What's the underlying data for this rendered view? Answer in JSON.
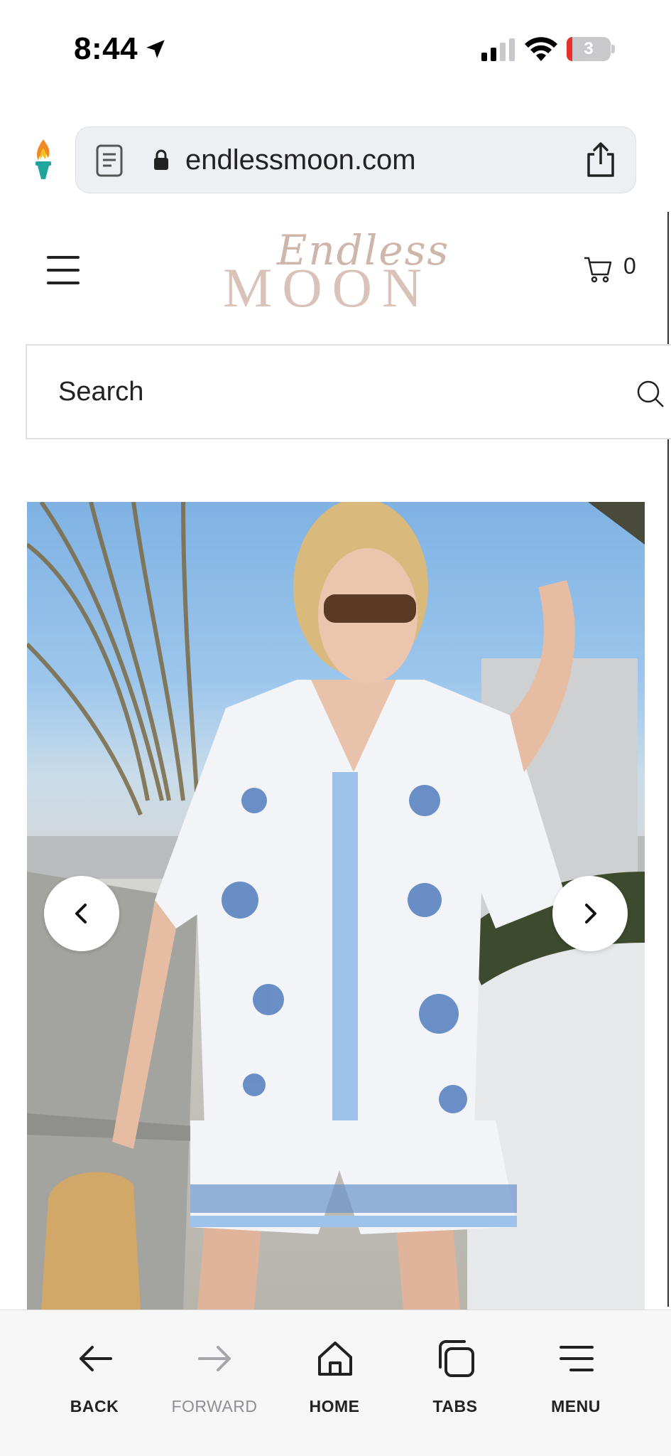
{
  "status_bar": {
    "time": "8:44",
    "battery_level": "3",
    "icons": [
      "location-arrow-icon",
      "cellular-signal-icon",
      "wifi-icon",
      "battery-icon"
    ]
  },
  "browser": {
    "url": "endlessmoon.com",
    "icons": [
      "torch-icon",
      "reader-icon",
      "lock-icon",
      "share-icon"
    ]
  },
  "site": {
    "logo_main": "MOON",
    "logo_script": "Endless",
    "cart_count": "0",
    "search_placeholder": "Search"
  },
  "toolbar": {
    "items": [
      {
        "label": "BACK",
        "icon": "back-arrow-icon",
        "enabled": true
      },
      {
        "label": "FORWARD",
        "icon": "forward-arrow-icon",
        "enabled": false
      },
      {
        "label": "HOME",
        "icon": "home-icon",
        "enabled": true
      },
      {
        "label": "TABS",
        "icon": "tabs-icon",
        "enabled": true
      },
      {
        "label": "MENU",
        "icon": "menu-icon",
        "enabled": true
      }
    ]
  },
  "colors": {
    "logo": "#d9c3b8",
    "url_bar_bg": "#edeff3",
    "toolbar_bg": "#f7f7f8",
    "disabled_label": "#8e8e93"
  }
}
